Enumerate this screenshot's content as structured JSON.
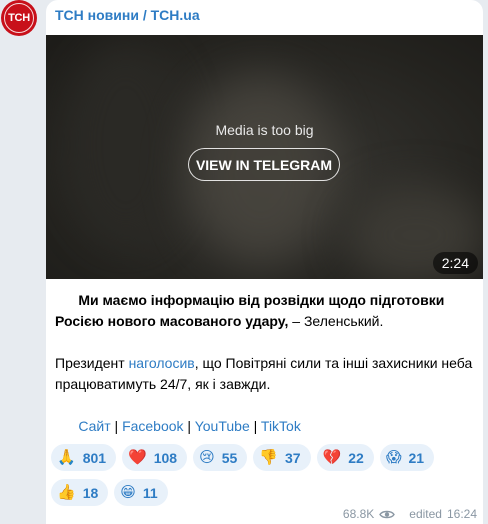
{
  "channel": {
    "avatar_text": "ТСН",
    "name": "ТСН новини / ТСН.ua"
  },
  "media": {
    "message": "Media is too big",
    "button_label": "VIEW IN TELEGRAM",
    "duration": "2:24"
  },
  "post": {
    "headline_bold": "Ми маємо інформацію від розвідки щодо підготовки Росією нового масованого удару,",
    "headline_rest": " – Зеленський.",
    "p2_before": "Президент ",
    "p2_link": "наголосив",
    "p2_after": ", що Повітряні сили та інші захисники неба працюватимуть 24/7, як і завжди.",
    "links": [
      "Сайт",
      "Facebook",
      "YouTube",
      "TikTok"
    ],
    "separator": " | "
  },
  "reactions": [
    {
      "emoji": "🙏",
      "count": "801"
    },
    {
      "emoji": "❤️",
      "count": "108"
    },
    {
      "emoji": "😢",
      "count": "55"
    },
    {
      "emoji": "👎",
      "count": "37"
    },
    {
      "emoji": "💔",
      "count": "22"
    },
    {
      "emoji": "😱",
      "count": "21"
    },
    {
      "emoji": "👍",
      "count": "18"
    },
    {
      "emoji": "😁",
      "count": "11"
    }
  ],
  "meta": {
    "views": "68.8K",
    "eye_icon": "eye-icon",
    "edited_label": "edited",
    "time": "16:24"
  },
  "colors": {
    "link": "#2e7cc4",
    "avatar": "#c8101a",
    "reaction_bg": "#e8f1fa",
    "meta": "#8a97a3"
  }
}
